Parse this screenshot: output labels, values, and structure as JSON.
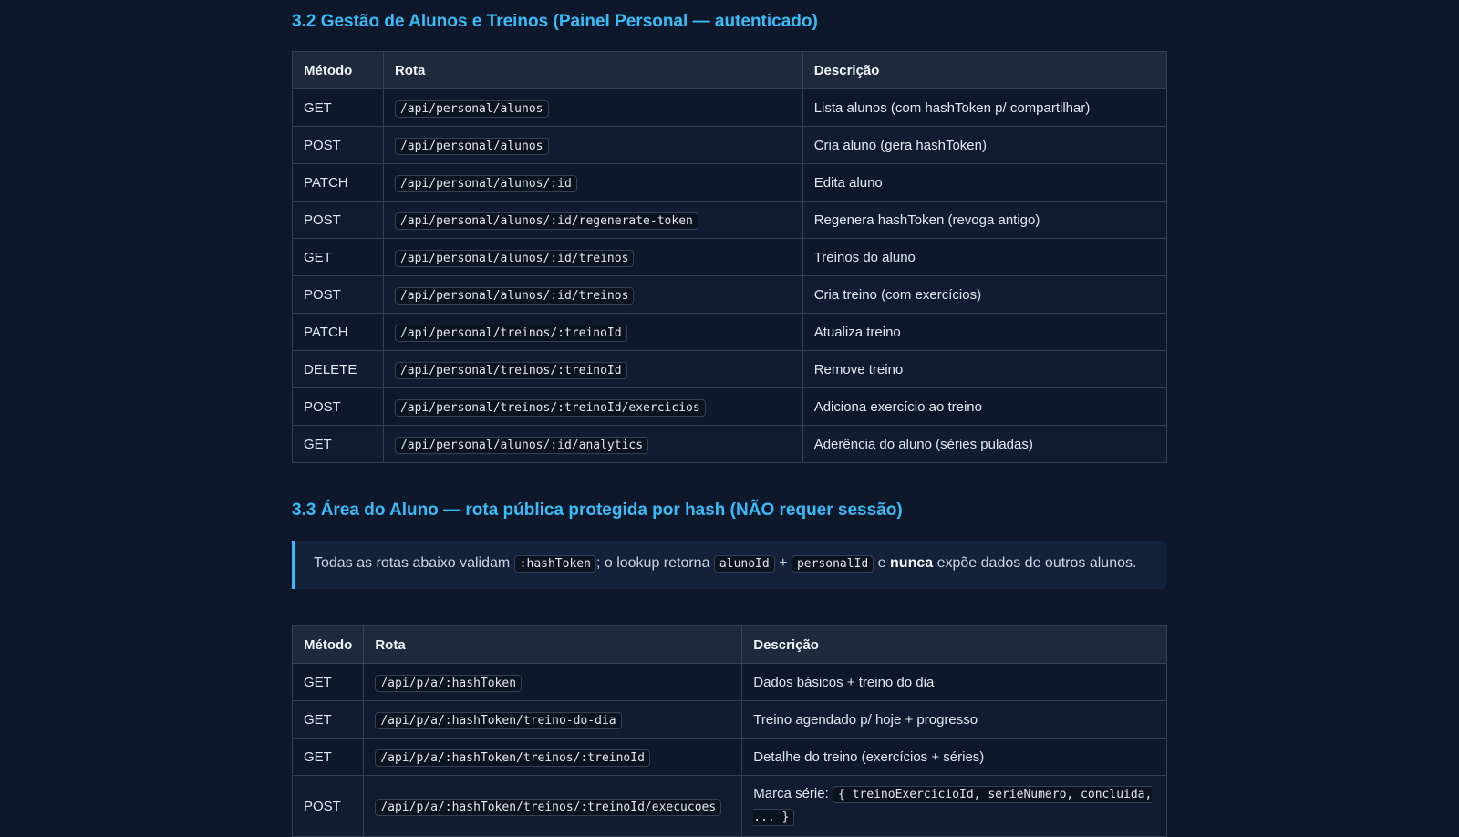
{
  "section_32": {
    "title": "3.2 Gestão de Alunos e Treinos (Painel Personal — autenticado)",
    "headers": [
      "Método",
      "Rota",
      "Descrição"
    ],
    "rows": [
      {
        "method": "GET",
        "route": "/api/personal/alunos",
        "desc": "Lista alunos (com hashToken p/ compartilhar)"
      },
      {
        "method": "POST",
        "route": "/api/personal/alunos",
        "desc": "Cria aluno (gera hashToken)"
      },
      {
        "method": "PATCH",
        "route": "/api/personal/alunos/:id",
        "desc": "Edita aluno"
      },
      {
        "method": "POST",
        "route": "/api/personal/alunos/:id/regenerate-token",
        "desc": "Regenera hashToken (revoga antigo)"
      },
      {
        "method": "GET",
        "route": "/api/personal/alunos/:id/treinos",
        "desc": "Treinos do aluno"
      },
      {
        "method": "POST",
        "route": "/api/personal/alunos/:id/treinos",
        "desc": "Cria treino (com exercícios)"
      },
      {
        "method": "PATCH",
        "route": "/api/personal/treinos/:treinoId",
        "desc": "Atualiza treino"
      },
      {
        "method": "DELETE",
        "route": "/api/personal/treinos/:treinoId",
        "desc": "Remove treino"
      },
      {
        "method": "POST",
        "route": "/api/personal/treinos/:treinoId/exercicios",
        "desc": "Adiciona exercício ao treino"
      },
      {
        "method": "GET",
        "route": "/api/personal/alunos/:id/analytics",
        "desc": "Aderência do aluno (séries puladas)"
      }
    ]
  },
  "section_33": {
    "title": "3.3 Área do Aluno — rota pública protegida por hash (NÃO requer sessão)",
    "callout": {
      "t1": "Todas as rotas abaixo validam ",
      "c1": ":hashToken",
      "t2": "; o lookup retorna ",
      "c2": "alunoId",
      "t3": " + ",
      "c3": "personalId",
      "t4": " e ",
      "bold": "nunca",
      "t5": " expõe dados de outros alunos."
    },
    "headers": [
      "Método",
      "Rota",
      "Descrição"
    ],
    "rows": [
      {
        "method": "GET",
        "route": "/api/p/a/:hashToken",
        "desc": "Dados básicos + treino do dia"
      },
      {
        "method": "GET",
        "route": "/api/p/a/:hashToken/treino-do-dia",
        "desc": "Treino agendado p/ hoje + progresso"
      },
      {
        "method": "GET",
        "route": "/api/p/a/:hashToken/treinos/:treinoId",
        "desc": "Detalhe do treino (exercícios + séries)"
      }
    ],
    "last_row": {
      "method": "POST",
      "route": "/api/p/a/:hashToken/treinos/:treinoId/execucoes",
      "desc_prefix": "Marca série: ",
      "desc_code": "{ treinoExercicioId, serieNumero, concluida, ... }"
    }
  }
}
